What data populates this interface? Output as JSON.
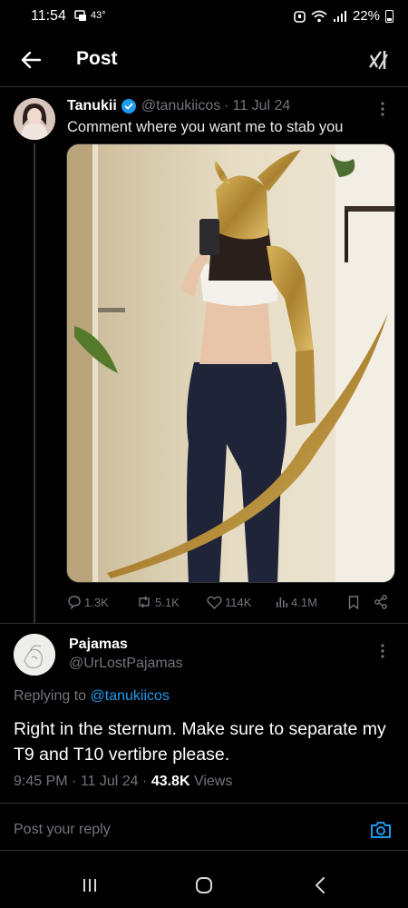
{
  "status_bar": {
    "time": "11:54",
    "temperature": "43°",
    "battery": "22%"
  },
  "header": {
    "title": "Post",
    "back_icon": "arrow-left-icon",
    "grok_icon": "grok-icon"
  },
  "tweet": {
    "author_name": "Tanukii",
    "handle": "@tanukiicos",
    "separator": "·",
    "date": "11 Jul 24",
    "text": "Comment where you want me to stab you",
    "media_description_icon": "photo",
    "stats": {
      "replies": "1.3K",
      "reposts": "5.1K",
      "likes": "114K",
      "views": "4.1M"
    }
  },
  "reply": {
    "author_name": "Pajamas",
    "handle": "@UrLostPajamas",
    "replying_prefix": "Replying to",
    "replying_to": "@tanukiicos",
    "text": "Right in the sternum. Make sure to separate my T9 and T10 vertibre please.",
    "time": "9:45 PM",
    "date": "11 Jul 24",
    "views_count": "43.8K",
    "views_label": "Views"
  },
  "compose": {
    "placeholder": "Post your reply"
  },
  "colors": {
    "background": "#000000",
    "accent": "#1d9bf0",
    "secondary_text": "#71767b",
    "divider": "#2f3336"
  }
}
